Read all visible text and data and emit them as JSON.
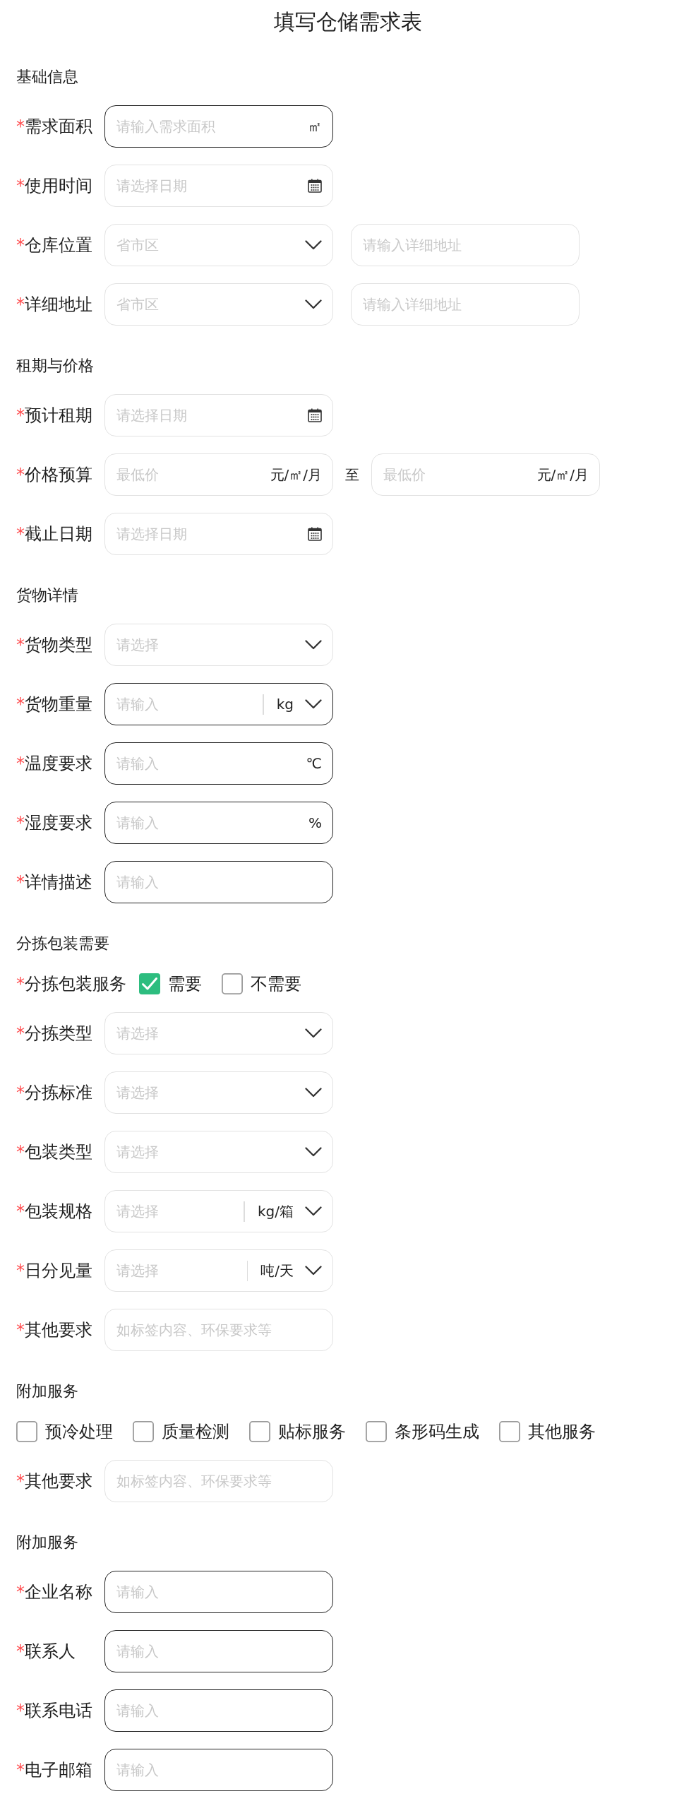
{
  "title": "填写仓储需求表",
  "sections": [
    {
      "heading": "基础信息",
      "rows": [
        {
          "kind": "field",
          "mark": "*",
          "label": "需求面积",
          "inputs": [
            {
              "kind": "text",
              "placeholder": "请输入需求面积",
              "suffix": "㎡",
              "highlighted": true
            }
          ]
        },
        {
          "kind": "field",
          "mark": "*",
          "label": "使用时间",
          "inputs": [
            {
              "kind": "date",
              "placeholder": "请选择日期",
              "highlighted": false
            }
          ]
        },
        {
          "kind": "field",
          "mark": "*",
          "label": "仓库位置",
          "inputs": [
            {
              "kind": "select",
              "placeholder": "省市区",
              "highlighted": false
            },
            {
              "kind": "text",
              "placeholder": "请输入详细地址",
              "highlighted": false
            }
          ]
        },
        {
          "kind": "field",
          "mark": "*",
          "label": "详细地址",
          "inputs": [
            {
              "kind": "select",
              "placeholder": "省市区",
              "highlighted": false
            },
            {
              "kind": "text",
              "placeholder": "请输入详细地址",
              "highlighted": false
            }
          ]
        }
      ]
    },
    {
      "heading": "租期与价格",
      "rows": [
        {
          "kind": "field",
          "mark": "*",
          "label": "预计租期",
          "inputs": [
            {
              "kind": "date",
              "placeholder": "请选择日期",
              "highlighted": false
            }
          ]
        },
        {
          "kind": "field",
          "mark": "*",
          "label": "价格预算",
          "separator": "至",
          "inputs": [
            {
              "kind": "text",
              "placeholder": "最低价",
              "suffix": "元/㎡/月",
              "highlighted": false
            },
            {
              "kind": "text",
              "placeholder": "最低价",
              "suffix": "元/㎡/月",
              "highlighted": false
            }
          ]
        },
        {
          "kind": "field",
          "mark": "*",
          "label": "截止日期",
          "inputs": [
            {
              "kind": "date",
              "placeholder": "请选择日期",
              "highlighted": false
            }
          ]
        }
      ]
    },
    {
      "heading": "货物详情",
      "rows": [
        {
          "kind": "field",
          "mark": "*",
          "label": "货物类型",
          "inputs": [
            {
              "kind": "select",
              "placeholder": "请选择",
              "highlighted": false
            }
          ]
        },
        {
          "kind": "field",
          "mark": "*",
          "label": "货物重量",
          "inputs": [
            {
              "kind": "unit_select",
              "placeholder": "请输入",
              "unit": "kg",
              "highlighted": true
            }
          ]
        },
        {
          "kind": "field",
          "mark": "*",
          "label": "温度要求",
          "inputs": [
            {
              "kind": "text",
              "placeholder": "请输入",
              "suffix": "℃",
              "highlighted": true
            }
          ]
        },
        {
          "kind": "field",
          "mark": "*",
          "label": "湿度要求",
          "inputs": [
            {
              "kind": "text",
              "placeholder": "请输入",
              "suffix": "%",
              "highlighted": true
            }
          ]
        },
        {
          "kind": "field",
          "mark": "*",
          "label": "详情描述",
          "inputs": [
            {
              "kind": "text",
              "placeholder": "请输入",
              "highlighted": true
            }
          ]
        }
      ]
    },
    {
      "heading": "分拣包装需要",
      "rows": [
        {
          "kind": "choice",
          "mark": "*",
          "label": "分拣包装服务",
          "options": [
            {
              "label": "需要",
              "checked": true
            },
            {
              "label": "不需要",
              "checked": false
            }
          ]
        },
        {
          "kind": "field",
          "mark": "*",
          "label": "分拣类型",
          "inputs": [
            {
              "kind": "select",
              "placeholder": "请选择",
              "highlighted": false
            }
          ]
        },
        {
          "kind": "field",
          "mark": "*",
          "label": "分拣标准",
          "inputs": [
            {
              "kind": "select",
              "placeholder": "请选择",
              "highlighted": false
            }
          ]
        },
        {
          "kind": "field",
          "mark": "*",
          "label": "包装类型",
          "inputs": [
            {
              "kind": "select",
              "placeholder": "请选择",
              "highlighted": false
            }
          ]
        },
        {
          "kind": "field",
          "mark": "*",
          "label": "包装规格",
          "inputs": [
            {
              "kind": "unit_select",
              "placeholder": "请选择",
              "unit": "kg/箱",
              "highlighted": false
            }
          ]
        },
        {
          "kind": "field",
          "mark": "*",
          "label": "日分见量",
          "inputs": [
            {
              "kind": "unit_select",
              "placeholder": "请选择",
              "unit": "吨/天",
              "highlighted": false
            }
          ]
        },
        {
          "kind": "field",
          "mark": "*",
          "label": "其他要求",
          "inputs": [
            {
              "kind": "text",
              "placeholder": "如标签内容、环保要求等",
              "highlighted": false
            }
          ]
        }
      ]
    },
    {
      "heading": "附加服务",
      "rows": [
        {
          "kind": "choice",
          "options": [
            {
              "label": "预冷处理",
              "checked": false
            },
            {
              "label": "质量检测",
              "checked": false
            },
            {
              "label": "贴标服务",
              "checked": false
            },
            {
              "label": "条形码生成",
              "checked": false
            },
            {
              "label": "其他服务",
              "checked": false
            }
          ]
        },
        {
          "kind": "field",
          "mark": "*",
          "label": "其他要求",
          "inputs": [
            {
              "kind": "text",
              "placeholder": "如标签内容、环保要求等",
              "highlighted": false
            }
          ]
        }
      ]
    },
    {
      "heading": "附加服务",
      "rows": [
        {
          "kind": "field",
          "mark": "*",
          "label": "企业名称",
          "inputs": [
            {
              "kind": "text",
              "placeholder": "请输入",
              "highlighted": true
            }
          ]
        },
        {
          "kind": "field",
          "mark": "*",
          "label": "联系人",
          "inputs": [
            {
              "kind": "text",
              "placeholder": "请输入",
              "highlighted": true
            }
          ]
        },
        {
          "kind": "field",
          "mark": "*",
          "label": "联系电话",
          "inputs": [
            {
              "kind": "text",
              "placeholder": "请输入",
              "highlighted": true
            }
          ]
        },
        {
          "kind": "field",
          "mark": "*",
          "label": "电子邮箱",
          "inputs": [
            {
              "kind": "text",
              "placeholder": "请输入",
              "highlighted": true
            }
          ]
        }
      ]
    }
  ]
}
